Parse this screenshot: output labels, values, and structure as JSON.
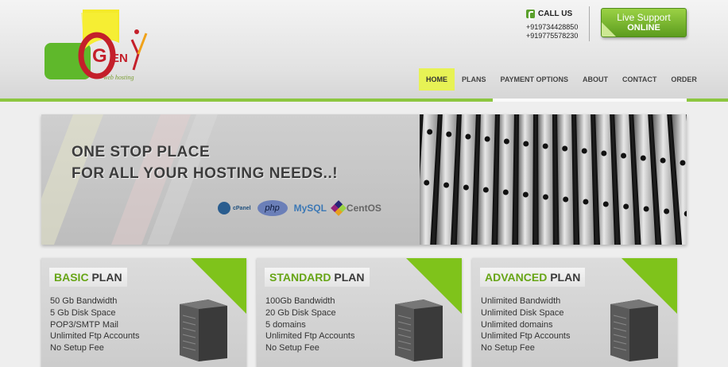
{
  "logo": {
    "name": "GenX",
    "tagline": "web hosting"
  },
  "contact": {
    "call_label": "CALL US",
    "phones": [
      "+919734428850",
      "+919775578230"
    ]
  },
  "live_support": {
    "line1": "Live Support",
    "line2": "ONLINE"
  },
  "nav": {
    "items": [
      {
        "label": "HOME",
        "active": true
      },
      {
        "label": "PLANS",
        "active": false
      },
      {
        "label": "PAYMENT OPTIONS",
        "active": false
      },
      {
        "label": "ABOUT",
        "active": false
      },
      {
        "label": "CONTACT",
        "active": false
      },
      {
        "label": "ORDER",
        "active": false
      }
    ]
  },
  "banner": {
    "line1": "ONE STOP PLACE",
    "line2": "FOR ALL YOUR HOSTING NEEDS..!",
    "tech": {
      "cpanel": "cPanel",
      "php": "php",
      "mysql": "MySQL",
      "centos": "CentOS"
    }
  },
  "plans": [
    {
      "title_green": "BASIC",
      "title_dark": "PLAN",
      "features": [
        "50 Gb Bandwidth",
        "5 Gb Disk Space",
        "POP3/SMTP Mail",
        "Unlimited Ftp Accounts",
        "No Setup Fee"
      ]
    },
    {
      "title_green": "STANDARD",
      "title_dark": "PLAN",
      "features": [
        "100Gb Bandwidth",
        "20 Gb Disk Space",
        "5 domains",
        "Unlimited Ftp Accounts",
        "No Setup Fee"
      ]
    },
    {
      "title_green": "ADVANCED",
      "title_dark": "PLAN",
      "features": [
        "Unlimited Bandwidth",
        "Unlimited Disk Space",
        "Unlimited domains",
        "Unlimited Ftp Accounts",
        "No Setup Fee"
      ]
    }
  ],
  "colors": {
    "brand_green": "#8cc63f",
    "nav_active": "#e7f255",
    "plan_accent": "#7fc31b"
  }
}
